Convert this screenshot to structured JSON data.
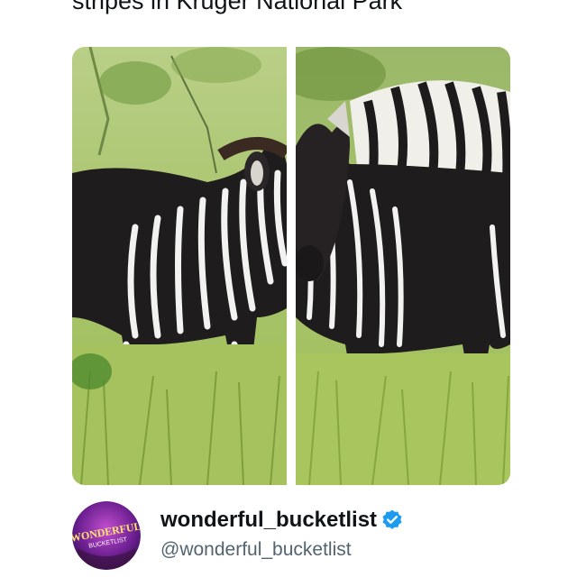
{
  "post": {
    "title": "stripes in Kruger National Park"
  },
  "media": {
    "images": [
      {
        "alt": "zebra-left"
      },
      {
        "alt": "zebra-right"
      }
    ]
  },
  "author": {
    "avatar_text_top": "WONDERFUL",
    "avatar_text_bottom": "BUCKETLIST",
    "display_name": "wonderful_bucketlist",
    "handle": "@wonderful_bucketlist",
    "verified_icon": "verified-badge-icon",
    "verified_color": "#1d9bf0"
  },
  "colors": {
    "text_primary": "#0f1419",
    "text_secondary": "#536471",
    "grass": "#a7c46a"
  }
}
